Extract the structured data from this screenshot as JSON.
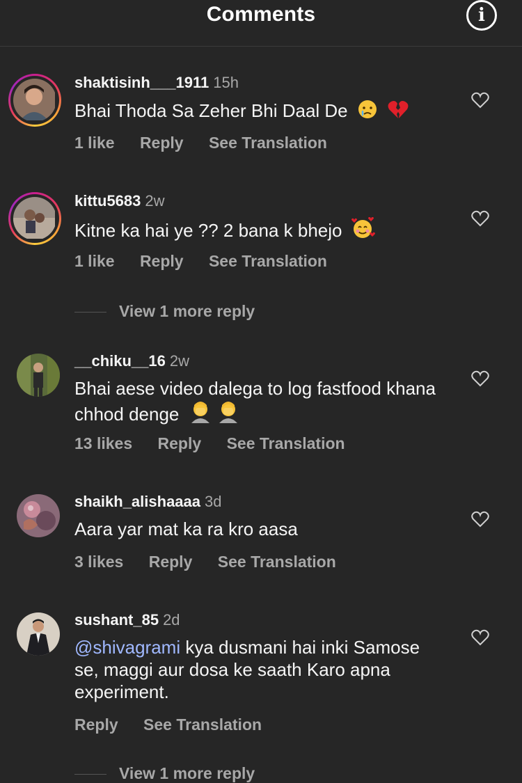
{
  "header": {
    "title": "Comments",
    "info_icon": "info-icon"
  },
  "comments": [
    {
      "username": "shaktisinh___1911",
      "time": "15h",
      "text": "Bhai Thoda Sa Zeher Bhi Daal De",
      "emojis": [
        "crying-face",
        "broken-heart"
      ],
      "likes": "1 like",
      "reply": "Reply",
      "translate": "See Translation",
      "has_story_ring": true
    },
    {
      "username": "kittu5683",
      "time": "2w",
      "text": "Kitne ka hai ye ?? 2 bana k bhejo",
      "emojis": [
        "smiling-face-with-hearts"
      ],
      "likes": "1 like",
      "reply": "Reply",
      "translate": "See Translation",
      "has_story_ring": true,
      "view_replies": "View 1 more reply"
    },
    {
      "username": "__chiku__16",
      "time": "2w",
      "text": "Bhai aese video dalega to log fastfood khana chhod denge",
      "emojis": [
        "face-palm",
        "face-palm"
      ],
      "likes": "13 likes",
      "reply": "Reply",
      "translate": "See Translation",
      "has_story_ring": false
    },
    {
      "username": "shaikh_alishaaaa",
      "time": "3d",
      "text": "Aara yar mat ka ra kro aasa",
      "likes": "3 likes",
      "reply": "Reply",
      "translate": "See Translation",
      "has_story_ring": false
    },
    {
      "username": "sushant_85",
      "time": "2d",
      "mention": "@shivagrami",
      "text": " kya dusmani hai inki Samose se, maggi aur dosa ke saath Karo apna experiment.",
      "reply": "Reply",
      "translate": "See Translation",
      "has_story_ring": false,
      "view_replies": "View 1 more reply"
    }
  ],
  "colors": {
    "background": "#262626",
    "text": "#f5f5f5",
    "secondary": "#a8a8a8",
    "mention": "#a0b8ff"
  }
}
